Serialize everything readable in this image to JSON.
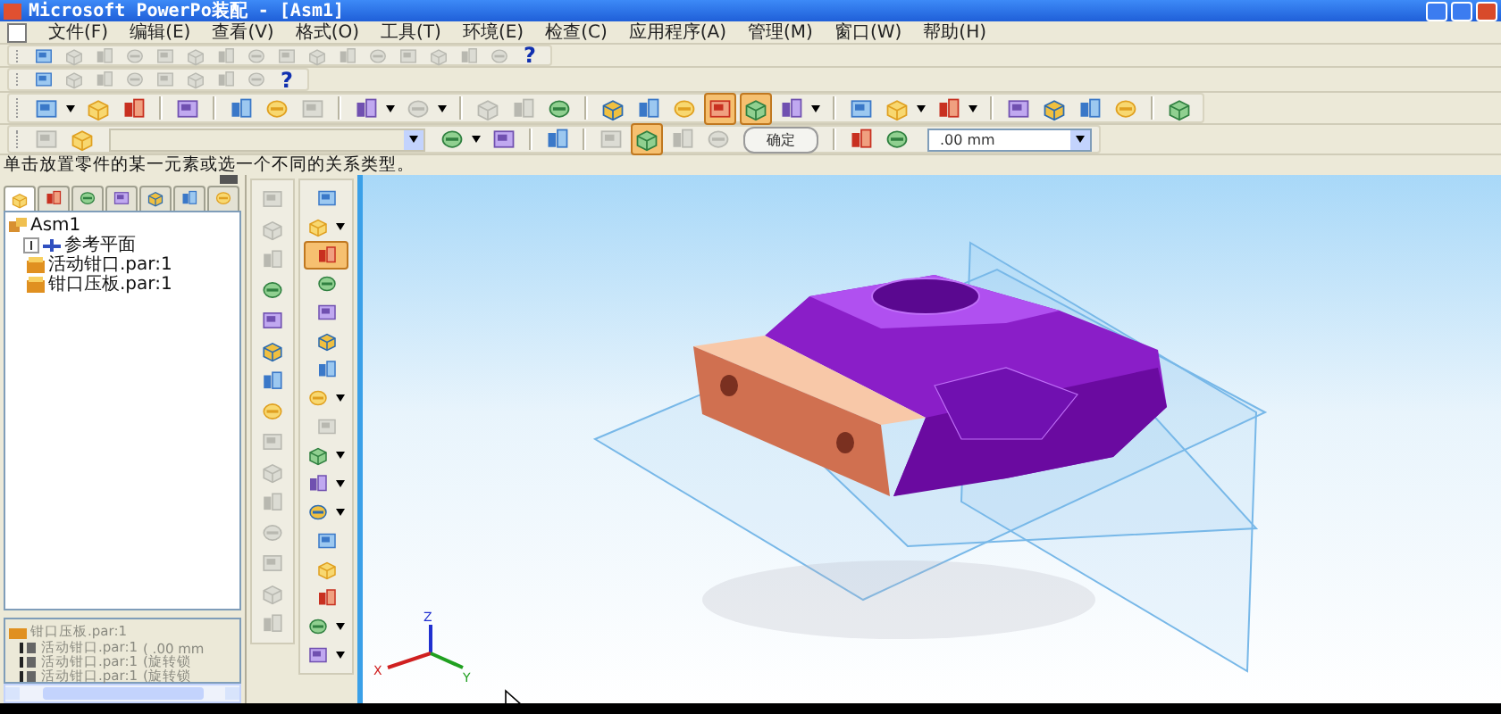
{
  "window": {
    "title": "Microsoft PowerPo装配 - [Asm1]",
    "menu": [
      "文件(F)",
      "编辑(E)",
      "查看(V)",
      "格式(O)",
      "工具(T)",
      "环境(E)",
      "检查(C)",
      "应用程序(A)",
      "管理(M)",
      "窗口(W)",
      "帮助(H)"
    ]
  },
  "toolbars": [
    {
      "items": [
        {
          "kind": "icon",
          "disabled": false,
          "pressed": false
        },
        {
          "kind": "icon",
          "disabled": true,
          "pressed": false
        },
        {
          "kind": "icon",
          "disabled": true,
          "pressed": false
        },
        {
          "kind": "icon",
          "disabled": true,
          "pressed": false
        },
        {
          "kind": "icon",
          "disabled": true,
          "pressed": false
        },
        {
          "kind": "icon",
          "disabled": true,
          "pressed": false
        },
        {
          "kind": "icon",
          "disabled": true,
          "pressed": false
        },
        {
          "kind": "icon",
          "disabled": true,
          "pressed": false
        },
        {
          "kind": "icon",
          "disabled": true,
          "pressed": false
        },
        {
          "kind": "icon",
          "disabled": true,
          "pressed": false
        },
        {
          "kind": "icon",
          "disabled": true,
          "pressed": false
        },
        {
          "kind": "icon",
          "disabled": true,
          "pressed": false
        },
        {
          "kind": "icon",
          "disabled": true,
          "pressed": false
        },
        {
          "kind": "icon",
          "disabled": true,
          "pressed": false
        },
        {
          "kind": "icon",
          "disabled": true,
          "pressed": false
        },
        {
          "kind": "icon",
          "disabled": true,
          "pressed": false
        },
        {
          "kind": "help",
          "label": "?"
        }
      ]
    },
    {
      "items": [
        {
          "kind": "icon",
          "disabled": false,
          "pressed": false
        },
        {
          "kind": "icon",
          "disabled": true,
          "pressed": false
        },
        {
          "kind": "icon",
          "disabled": true,
          "pressed": false
        },
        {
          "kind": "icon",
          "disabled": true,
          "pressed": false
        },
        {
          "kind": "icon",
          "disabled": true,
          "pressed": false
        },
        {
          "kind": "icon",
          "disabled": true,
          "pressed": false
        },
        {
          "kind": "icon",
          "disabled": true,
          "pressed": false
        },
        {
          "kind": "icon",
          "disabled": true,
          "pressed": false
        },
        {
          "kind": "help",
          "label": "?"
        }
      ]
    },
    {
      "items": [
        {
          "kind": "split",
          "disabled": false,
          "pressed": false
        },
        {
          "kind": "icon",
          "disabled": false,
          "pressed": false
        },
        {
          "kind": "icon",
          "disabled": false,
          "pressed": false
        },
        {
          "kind": "sep"
        },
        {
          "kind": "icon",
          "disabled": false,
          "pressed": false
        },
        {
          "kind": "sep"
        },
        {
          "kind": "icon",
          "disabled": false,
          "pressed": false
        },
        {
          "kind": "icon",
          "disabled": false,
          "pressed": false
        },
        {
          "kind": "icon",
          "disabled": true,
          "pressed": false
        },
        {
          "kind": "sep"
        },
        {
          "kind": "split",
          "disabled": false,
          "pressed": false
        },
        {
          "kind": "split",
          "disabled": true,
          "pressed": false
        },
        {
          "kind": "sep"
        },
        {
          "kind": "icon",
          "disabled": true,
          "pressed": false
        },
        {
          "kind": "icon",
          "disabled": true,
          "pressed": false
        },
        {
          "kind": "icon",
          "disabled": false,
          "pressed": false
        },
        {
          "kind": "sep"
        },
        {
          "kind": "icon",
          "disabled": false,
          "pressed": false
        },
        {
          "kind": "icon",
          "disabled": false,
          "pressed": false
        },
        {
          "kind": "icon",
          "disabled": false,
          "pressed": false
        },
        {
          "kind": "icon",
          "disabled": false,
          "pressed": true
        },
        {
          "kind": "icon",
          "disabled": false,
          "pressed": true
        },
        {
          "kind": "split",
          "disabled": false,
          "pressed": false
        },
        {
          "kind": "sep"
        },
        {
          "kind": "icon",
          "disabled": false,
          "pressed": false
        },
        {
          "kind": "split",
          "disabled": false,
          "pressed": false
        },
        {
          "kind": "split",
          "disabled": false,
          "pressed": false
        },
        {
          "kind": "sep"
        },
        {
          "kind": "icon",
          "disabled": false,
          "pressed": false
        },
        {
          "kind": "icon",
          "disabled": false,
          "pressed": false
        },
        {
          "kind": "icon",
          "disabled": false,
          "pressed": false
        },
        {
          "kind": "icon",
          "disabled": false,
          "pressed": false
        },
        {
          "kind": "sep"
        },
        {
          "kind": "icon",
          "disabled": false,
          "pressed": false
        }
      ]
    },
    {
      "items": [
        {
          "kind": "icon",
          "disabled": true,
          "pressed": false
        },
        {
          "kind": "icon",
          "disabled": false,
          "pressed": false
        },
        {
          "kind": "combo"
        },
        {
          "kind": "split",
          "disabled": false,
          "pressed": false
        },
        {
          "kind": "icon",
          "disabled": false,
          "pressed": false
        },
        {
          "kind": "sep"
        },
        {
          "kind": "icon",
          "disabled": false,
          "pressed": false
        },
        {
          "kind": "sep"
        },
        {
          "kind": "icon",
          "disabled": true,
          "pressed": false
        },
        {
          "kind": "icon",
          "disabled": false,
          "pressed": true
        },
        {
          "kind": "icon",
          "disabled": true,
          "pressed": false
        },
        {
          "kind": "icon",
          "disabled": true,
          "pressed": false
        },
        {
          "kind": "button",
          "label": "确定"
        },
        {
          "kind": "sep"
        },
        {
          "kind": "icon",
          "disabled": false,
          "pressed": false
        },
        {
          "kind": "icon",
          "disabled": false,
          "pressed": false
        },
        {
          "kind": "select",
          "value": ".00 mm"
        }
      ]
    }
  ],
  "prompt": "单击放置零件的某一元素或选一个不同的关系类型。",
  "pathfinder": {
    "tabs": [
      {
        "selected": true
      },
      {
        "selected": false
      },
      {
        "selected": false
      },
      {
        "selected": false
      },
      {
        "selected": false
      },
      {
        "selected": false
      },
      {
        "selected": false
      }
    ],
    "tree": [
      {
        "label": "Asm1",
        "children": [
          {
            "label": "参考平面",
            "expanded": false
          },
          {
            "label": "活动钳口.par:1"
          },
          {
            "label": "钳口压板.par:1"
          }
        ]
      }
    ],
    "relations": {
      "part": "钳口压板.par:1",
      "items": [
        {
          "label": "活动钳口.par:1",
          "detail": "( .00 mm"
        },
        {
          "label": "活动钳口.par:1",
          "detail": "(旋转锁"
        },
        {
          "label": "活动钳口.par:1",
          "detail": "(旋转锁"
        }
      ]
    }
  },
  "side_toolbars": [
    [
      {
        "kind": "icon",
        "disabled": true,
        "pressed": false
      },
      {
        "kind": "icon",
        "disabled": true,
        "pressed": false
      },
      {
        "kind": "icon",
        "disabled": true,
        "pressed": false
      },
      {
        "kind": "icon",
        "disabled": false,
        "pressed": false
      },
      {
        "kind": "icon",
        "disabled": false,
        "pressed": false
      },
      {
        "kind": "icon",
        "disabled": false,
        "pressed": false
      },
      {
        "kind": "icon",
        "disabled": false,
        "pressed": false
      },
      {
        "kind": "icon",
        "disabled": false,
        "pressed": false
      },
      {
        "kind": "icon",
        "disabled": true,
        "pressed": false
      },
      {
        "kind": "icon",
        "disabled": true,
        "pressed": false
      },
      {
        "kind": "icon",
        "disabled": true,
        "pressed": false
      },
      {
        "kind": "icon",
        "disabled": true,
        "pressed": false
      },
      {
        "kind": "icon",
        "disabled": true,
        "pressed": false
      },
      {
        "kind": "icon",
        "disabled": true,
        "pressed": false
      },
      {
        "kind": "icon",
        "disabled": true,
        "pressed": false
      }
    ],
    [
      {
        "kind": "icon",
        "disabled": false,
        "pressed": false
      },
      {
        "kind": "split",
        "disabled": false,
        "pressed": false
      },
      {
        "kind": "icon",
        "disabled": false,
        "pressed": true
      },
      {
        "kind": "icon",
        "disabled": false,
        "pressed": false
      },
      {
        "kind": "icon",
        "disabled": false,
        "pressed": false
      },
      {
        "kind": "icon",
        "disabled": false,
        "pressed": false
      },
      {
        "kind": "icon",
        "disabled": false,
        "pressed": false
      },
      {
        "kind": "split",
        "disabled": false,
        "pressed": false
      },
      {
        "kind": "icon",
        "disabled": true,
        "pressed": false
      },
      {
        "kind": "split",
        "disabled": false,
        "pressed": false
      },
      {
        "kind": "split",
        "disabled": false,
        "pressed": false
      },
      {
        "kind": "split",
        "disabled": false,
        "pressed": false
      },
      {
        "kind": "icon",
        "disabled": false,
        "pressed": false
      },
      {
        "kind": "icon",
        "disabled": false,
        "pressed": false
      },
      {
        "kind": "icon",
        "disabled": false,
        "pressed": false
      },
      {
        "kind": "split",
        "disabled": false,
        "pressed": false
      },
      {
        "kind": "split",
        "disabled": false,
        "pressed": false
      }
    ]
  ],
  "viewport": {
    "axes": [
      "Z",
      "X",
      "Y"
    ]
  }
}
